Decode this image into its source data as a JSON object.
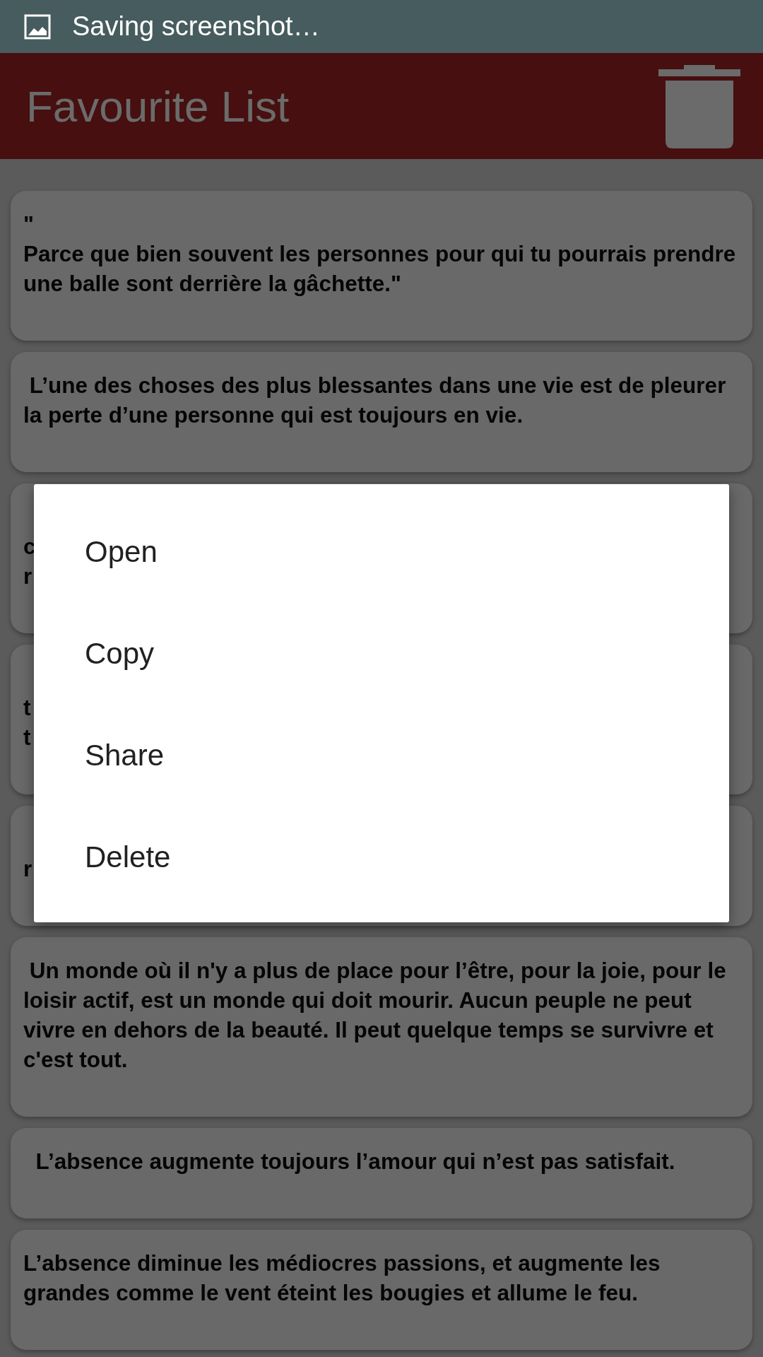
{
  "status_bar": {
    "notification": "Saving screenshot…"
  },
  "app_bar": {
    "title": "Favourite List"
  },
  "quotes": [
    {
      "text": "\"\nParce que bien souvent les personnes pour qui tu pourrais prendre une balle sont derrière la gâchette.\""
    },
    {
      "text": " L’une des choses des plus blessantes dans une vie est de pleurer la perte d’une personne qui est toujours en vie."
    },
    {
      "text": "\nc\nr"
    },
    {
      "text": "\nt\nt"
    },
    {
      "text": "\nr"
    },
    {
      "text": " Un monde où il n'y a plus de place pour l’être, pour la joie, pour le loisir actif, est un monde qui doit mourir. Aucun peuple ne peut vivre en dehors de la beauté. Il peut quelque temps se survivre et c'est tout."
    },
    {
      "text": "  L’absence augmente toujours l’amour qui n’est pas satisfait."
    },
    {
      "text": "L’absence diminue les médiocres passions, et augmente les grandes comme le vent éteint les bougies et allume le feu."
    }
  ],
  "menu": {
    "items": [
      "Open",
      "Copy",
      "Share",
      "Delete"
    ]
  }
}
